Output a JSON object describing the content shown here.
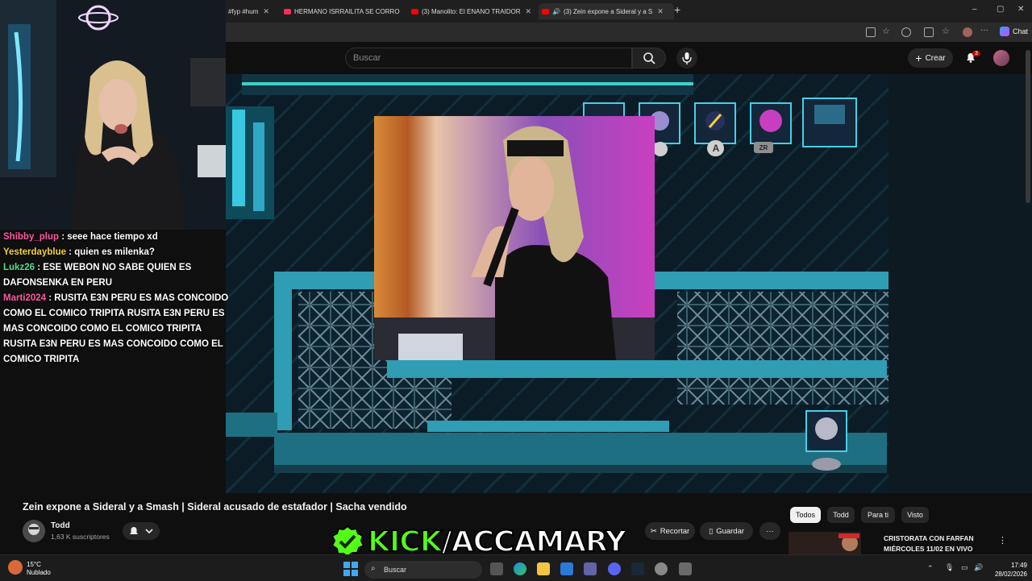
{
  "tabs": [
    {
      "label": "#fyp #hum",
      "fav": "#555"
    },
    {
      "label": "HERMANO ISRRAILITA SE CORRO",
      "fav": "#fe2c55"
    },
    {
      "label": "(3) Manolito: El ENANO TRAIDOR",
      "fav": "#ff0000"
    },
    {
      "label": "(3) Zein expone a Sideral y a S",
      "fav": "#ff0000"
    }
  ],
  "toolbar": {
    "chat_label": "Chat"
  },
  "youtube": {
    "search_placeholder": "Buscar",
    "create_label": "Crear",
    "notif_count": "3"
  },
  "chat": [
    {
      "user": "Shibby_plup",
      "color": "#ff5aa5",
      "msg": " : seee hace tiempo xd"
    },
    {
      "user": "Yesterdayblue",
      "color": "#f5d33b",
      "msg": " : quien es milenka?"
    },
    {
      "user": "Lukz26",
      "color": "#53e08a",
      "msg": " : ESE WEBON NO SABE QUIEN ES DAFONSENKA EN PERU"
    },
    {
      "user": "Marti2024",
      "color": "#ff5aa5",
      "msg": " : RUSITA E3N PERU ES MAS CONCOIDO COMO EL COMICO TRIPITA RUSITA E3N PERU ES MAS CONCOIDO COMO EL COMICO TRIPITA RUSITA E3N PERU ES MAS CONCOIDO COMO EL COMICO TRIPITA"
    }
  ],
  "game_hud": {
    "btn_a": "A",
    "btn_zr": "ZR"
  },
  "video": {
    "title": "Zein expone a Sideral y a Smash | Sideral acusado de estafador | Sacha vendido",
    "channel": "Todd",
    "subscribers": "1,63 K suscriptores"
  },
  "actions": {
    "clip": "Recortar",
    "save": "Guardar"
  },
  "chips": [
    "Todos",
    "Todd",
    "Para ti",
    "Visto"
  ],
  "overlay": {
    "kick": "KICK",
    "slash": "/",
    "user": "ACCAMARY"
  },
  "recommended": {
    "line1": "CRISTORATA CON FARFAN",
    "line2": "MIÉRCOLES 11/02 EN VIVO"
  },
  "taskbar": {
    "search": "Buscar",
    "temp": "15°C",
    "weather": "Nublado",
    "time": "17:49",
    "date": "28/02/2026"
  }
}
